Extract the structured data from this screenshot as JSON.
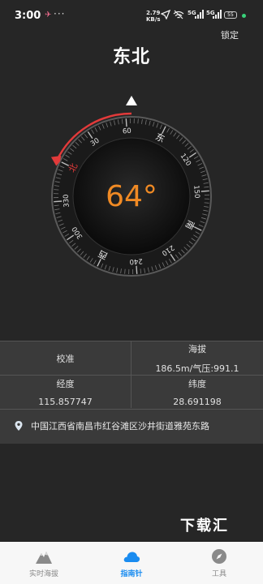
{
  "status_bar": {
    "time": "3:00",
    "net_speed_value": "2.79",
    "net_speed_unit": "KB/s",
    "signal_label_1": "5G",
    "signal_label_2": "5G",
    "battery": "55"
  },
  "header": {
    "lock_label": "锁定",
    "direction": "东北"
  },
  "compass": {
    "heading": 64,
    "heading_label": "64°",
    "accent_color": "#f08a24",
    "needle_color": "#e23a3a",
    "ticks": [
      {
        "angle": 0,
        "label": "北"
      },
      {
        "angle": 30,
        "label": "30"
      },
      {
        "angle": 60,
        "label": "60"
      },
      {
        "angle": 90,
        "label": "东"
      },
      {
        "angle": 120,
        "label": "120"
      },
      {
        "angle": 150,
        "label": "150"
      },
      {
        "angle": 180,
        "label": "南"
      },
      {
        "angle": 210,
        "label": "210"
      },
      {
        "angle": 240,
        "label": "240"
      },
      {
        "angle": 270,
        "label": "西"
      },
      {
        "angle": 300,
        "label": "300"
      },
      {
        "angle": 330,
        "label": "330"
      }
    ]
  },
  "info": {
    "calibrate_label": "校准",
    "altitude_label": "海拔",
    "altitude_value": "186.5m/气压:991.1",
    "longitude_label": "经度",
    "longitude_value": "115.857747",
    "latitude_label": "纬度",
    "latitude_value": "28.691198",
    "address": "中国江西省南昌市红谷滩区沙井街道雅苑东路"
  },
  "watermark": "下载汇",
  "nav": {
    "items": [
      {
        "label": "实时海拔",
        "icon": "mountain-icon"
      },
      {
        "label": "指南针",
        "icon": "cloud-icon"
      },
      {
        "label": "工具",
        "icon": "compass-icon"
      }
    ],
    "active_index": 1,
    "active_color": "#1a8cf0"
  }
}
